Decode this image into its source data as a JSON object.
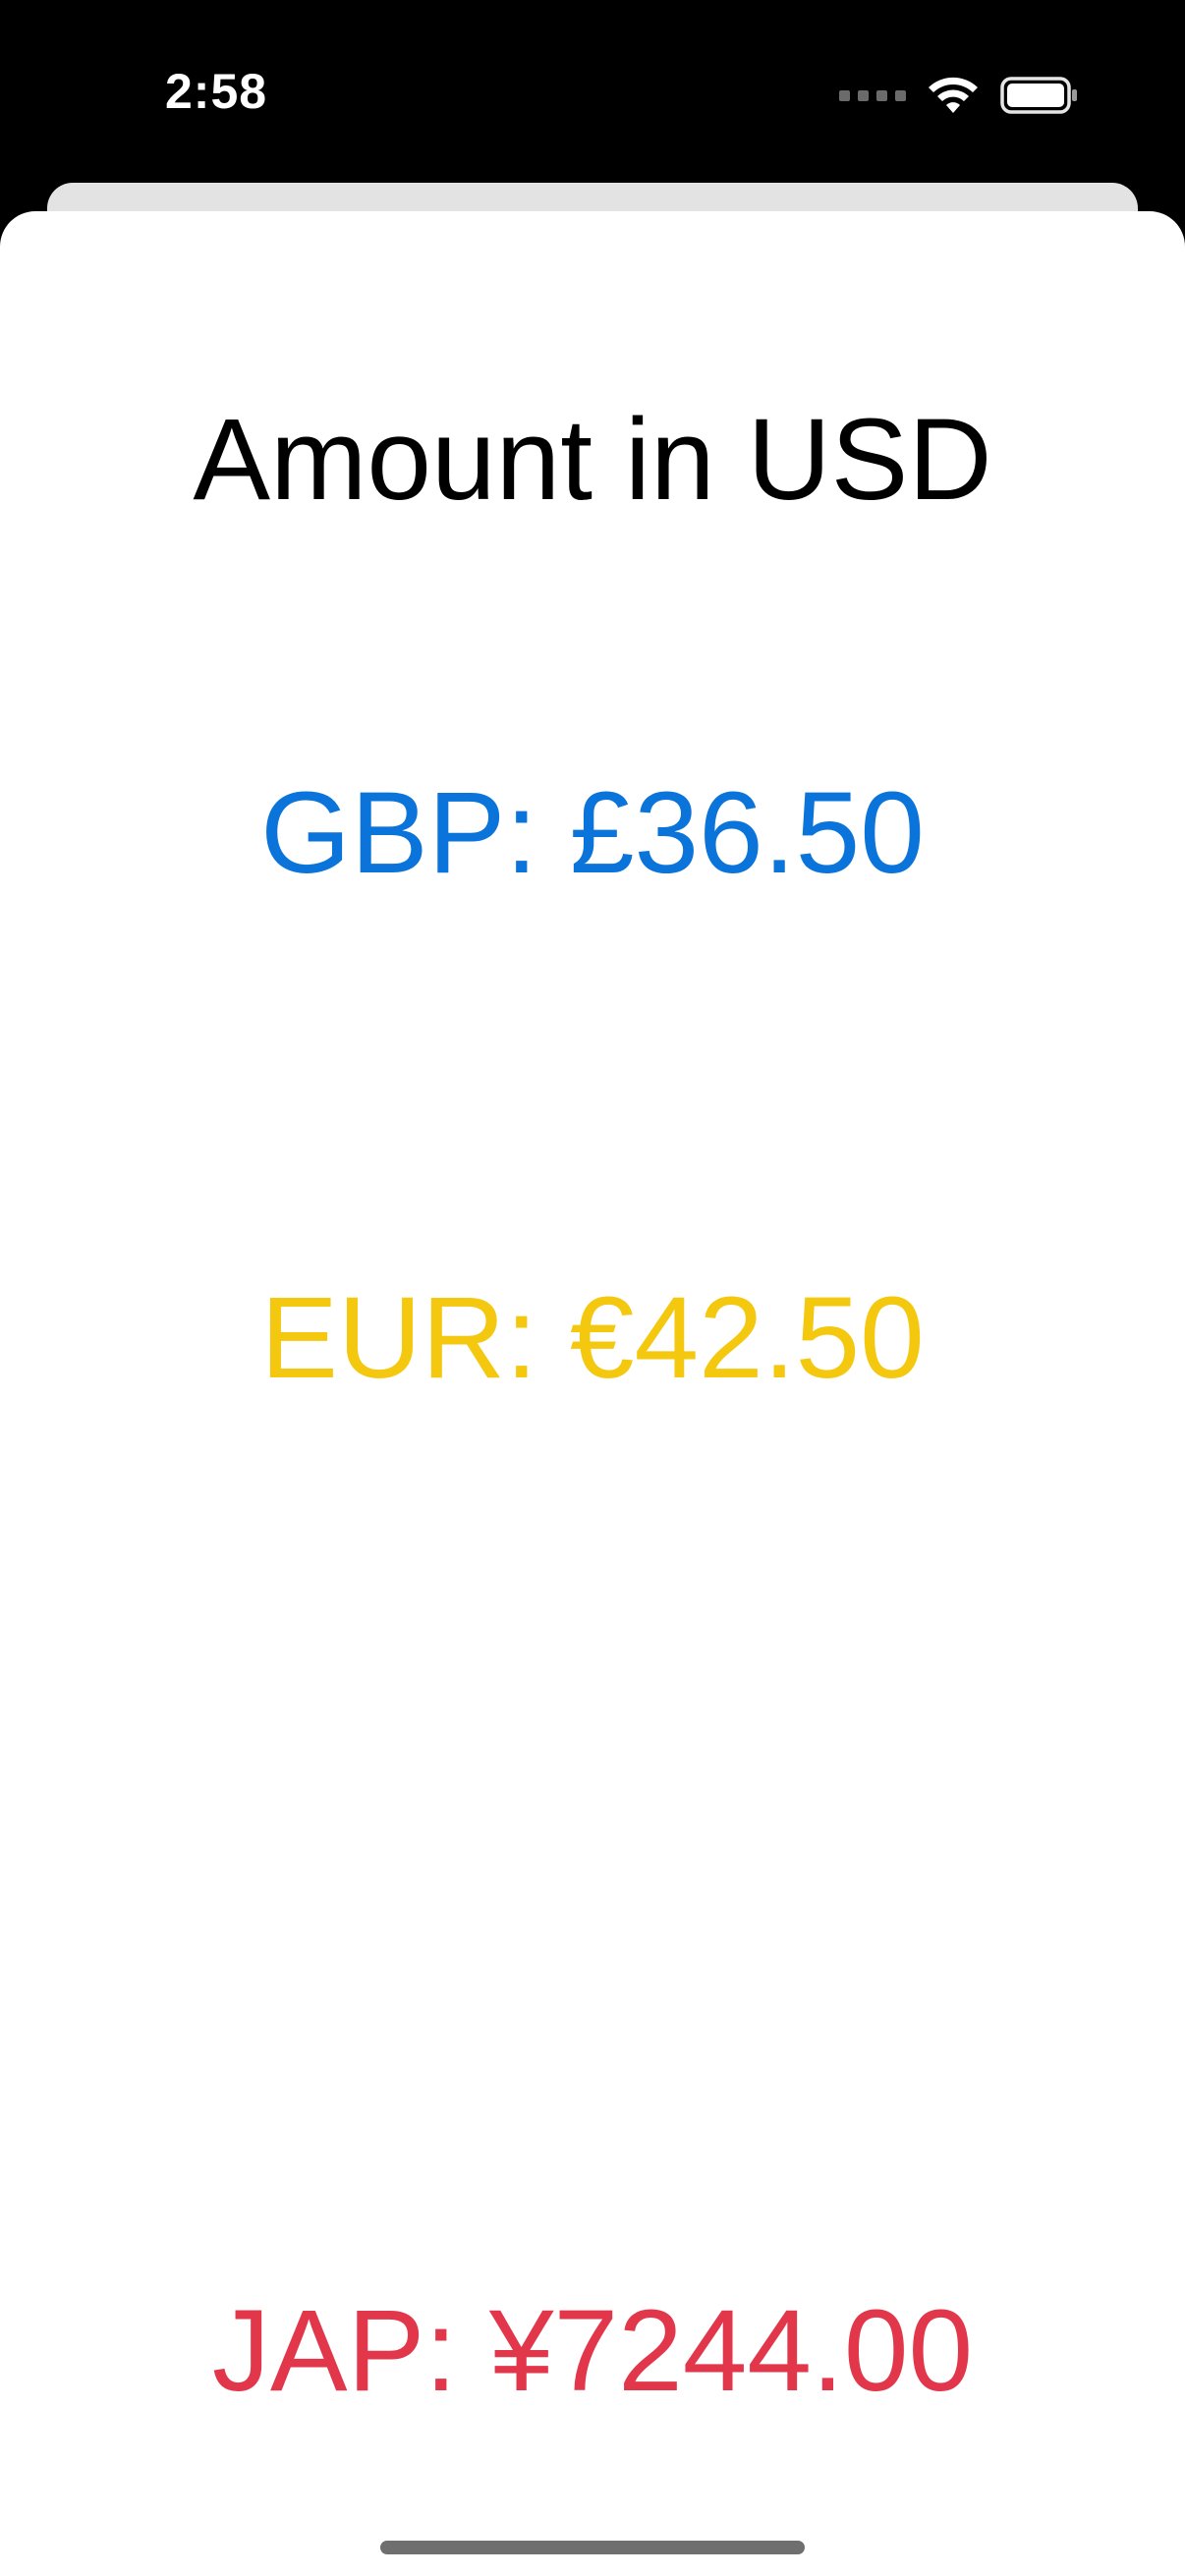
{
  "status_bar": {
    "time": "2:58",
    "icons": [
      "cellular-signal-icon",
      "wifi-icon",
      "battery-icon"
    ]
  },
  "screen": {
    "title": "Amount in USD",
    "rates": [
      {
        "label": "GBP: £36.50",
        "color": "#0A74DA"
      },
      {
        "label": "EUR: €42.50",
        "color": "#F5C810"
      },
      {
        "label": "JAP: ¥7244.00",
        "color": "#E2364B"
      }
    ]
  }
}
